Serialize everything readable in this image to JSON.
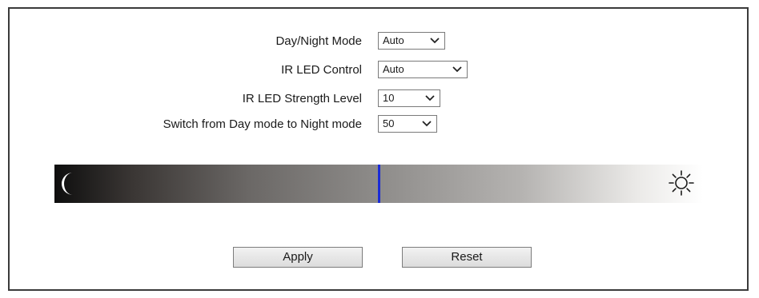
{
  "form": {
    "day_night_mode": {
      "label": "Day/Night Mode",
      "value": "Auto"
    },
    "ir_led_control": {
      "label": "IR LED Control",
      "value": "Auto"
    },
    "ir_led_strength": {
      "label": "IR LED Strength Level",
      "value": "10"
    },
    "switch_threshold": {
      "label": "Switch from Day mode to Night mode",
      "value": "50"
    }
  },
  "slider": {
    "value": 50,
    "min": 0,
    "max": 100,
    "left_icon": "moon-icon",
    "right_icon": "sun-icon",
    "marker_color": "#1b2bd6"
  },
  "buttons": {
    "apply_label": "Apply",
    "reset_label": "Reset"
  }
}
